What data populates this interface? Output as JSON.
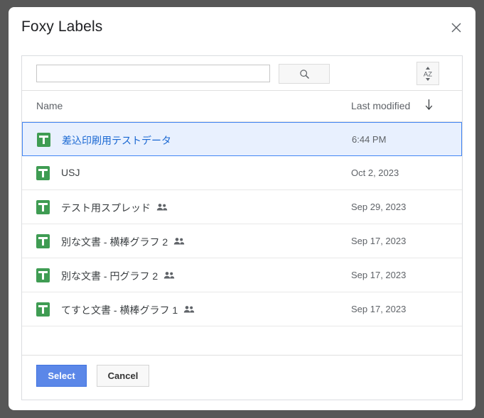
{
  "dialog": {
    "title": "Foxy Labels",
    "close_icon": "close-icon"
  },
  "toolbar": {
    "search_value": "",
    "search_placeholder": "",
    "search_button_icon": "search-icon",
    "sort_button_icon": "sort-alpha-icon",
    "sort_button_label": "AZ"
  },
  "columns": {
    "name": "Name",
    "last_modified": "Last modified",
    "sort_direction_icon": "arrow-down-icon"
  },
  "files": [
    {
      "name": "差込印刷用テストデータ",
      "modified": "6:44 PM",
      "shared": false,
      "selected": true,
      "icon": "google-sheets-icon"
    },
    {
      "name": "USJ",
      "modified": "Oct 2, 2023",
      "shared": false,
      "selected": false,
      "icon": "google-sheets-icon"
    },
    {
      "name": "テスト用スプレッド",
      "modified": "Sep 29, 2023",
      "shared": true,
      "selected": false,
      "icon": "google-sheets-icon"
    },
    {
      "name": "別な文書 - 横棒グラフ 2",
      "modified": "Sep 17, 2023",
      "shared": true,
      "selected": false,
      "icon": "google-sheets-icon"
    },
    {
      "name": "別な文書 - 円グラフ 2",
      "modified": "Sep 17, 2023",
      "shared": true,
      "selected": false,
      "icon": "google-sheets-icon"
    },
    {
      "name": "てすと文書 - 横棒グラフ 1",
      "modified": "Sep 17, 2023",
      "shared": true,
      "selected": false,
      "icon": "google-sheets-icon"
    }
  ],
  "footer": {
    "select_label": "Select",
    "cancel_label": "Cancel"
  },
  "colors": {
    "accent_blue": "#4285f4",
    "select_button": "#5b87e8",
    "selected_row_bg": "#e8f0fe",
    "selected_row_text": "#1967d2",
    "sheets_green": "#3f9c53",
    "backdrop": "#575757"
  }
}
